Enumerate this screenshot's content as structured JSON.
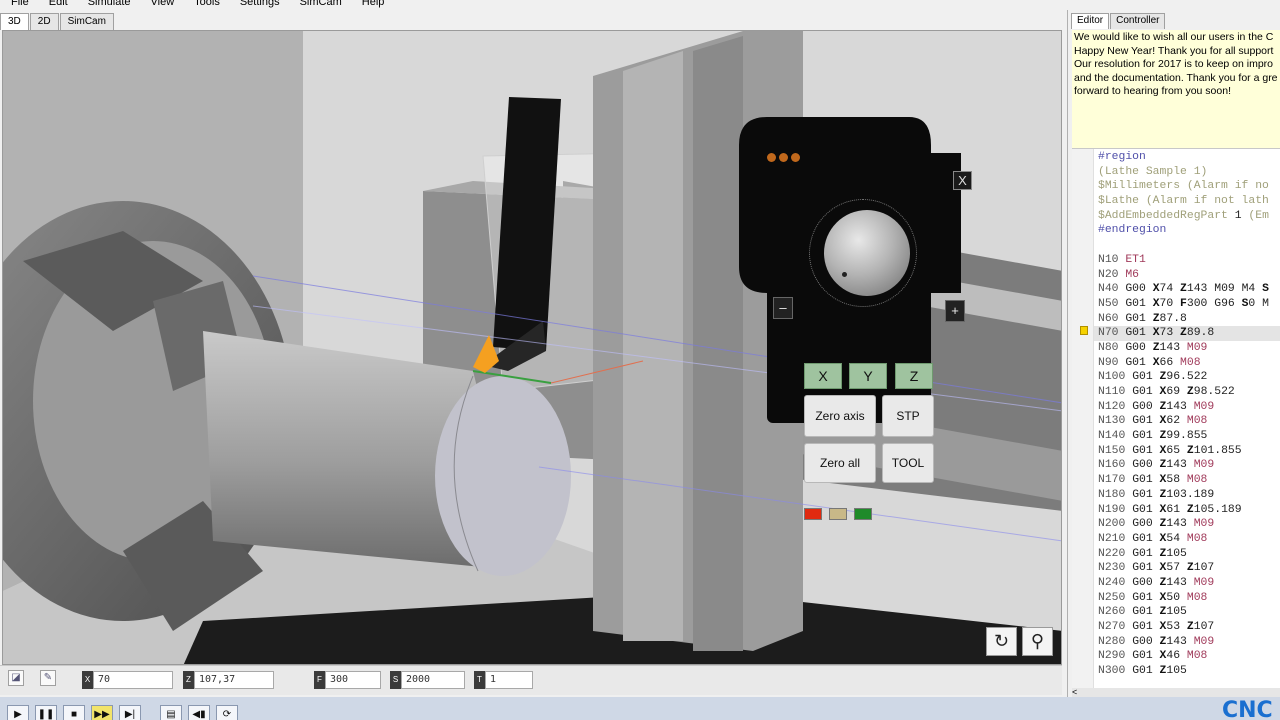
{
  "menu": [
    "File",
    "Edit",
    "Simulate",
    "View",
    "Tools",
    "Settings",
    "SimCam",
    "Help"
  ],
  "view_tabs": [
    "3D",
    "2D",
    "SimCam"
  ],
  "right_tabs": [
    "Editor",
    "Controller"
  ],
  "message": [
    "We would like to wish all our users in the C",
    "Happy New Year! Thank you for all support",
    "Our resolution for 2017 is to keep on impro",
    "and the documentation. Thank you for a gre",
    "forward to hearing from you soon!"
  ],
  "pendant": {
    "close": "X",
    "minus": "–",
    "plus": "+",
    "axes": [
      "X",
      "Y",
      "Z"
    ],
    "zero_axis": "Zero axis",
    "stp": "STP",
    "zero_all": "Zero all",
    "tool": "TOOL"
  },
  "statusbar": {
    "x": {
      "label": "X",
      "value": "70"
    },
    "z": {
      "label": "Z",
      "value": "107,37"
    },
    "f": {
      "label": "F",
      "value": "300"
    },
    "s": {
      "label": "S",
      "value": "2000"
    },
    "t": {
      "label": "T",
      "value": "1"
    }
  },
  "brand": "CNC",
  "colors": {
    "led_red": "#e02a10",
    "led_tan": "#c8b888",
    "led_green": "#1f8a2a",
    "tool_orange": "#f5a020",
    "axis_green": "#9fc39f"
  },
  "code_lines": [
    [
      [
        "#region",
        "kw"
      ]
    ],
    [
      [
        "(Lathe Sample 1)",
        "cm"
      ]
    ],
    [
      [
        "$Millimeters (Alarm if no",
        "cm"
      ]
    ],
    [
      [
        "$Lathe (Alarm if not lath",
        "cm"
      ]
    ],
    [
      [
        "$AddEmbeddedRegPart ",
        "cm"
      ],
      [
        "1",
        "n"
      ],
      [
        " (Em",
        "cm"
      ]
    ],
    [
      [
        "#endregion",
        "kw"
      ]
    ],
    [
      [
        "",
        ""
      ]
    ],
    [
      [
        "N10 ",
        "g"
      ],
      [
        "ET1",
        "m"
      ]
    ],
    [
      [
        "N20 ",
        "g"
      ],
      [
        "M6",
        "m"
      ]
    ],
    [
      [
        "N40 ",
        "g"
      ],
      [
        "G00 ",
        "n"
      ],
      [
        "X",
        "x"
      ],
      [
        "74 ",
        "n"
      ],
      [
        "Z",
        "x"
      ],
      [
        "143 ",
        "n"
      ],
      [
        "M09 M4 ",
        "n"
      ],
      [
        "S",
        "x"
      ]
    ],
    [
      [
        "N50 ",
        "g"
      ],
      [
        "G01 ",
        "n"
      ],
      [
        "X",
        "x"
      ],
      [
        "70 ",
        "n"
      ],
      [
        "F",
        "x"
      ],
      [
        "300 ",
        "n"
      ],
      [
        "G96 ",
        "n"
      ],
      [
        "S",
        "x"
      ],
      [
        "0 M",
        "n"
      ]
    ],
    [
      [
        "N60 ",
        "g"
      ],
      [
        "G01 ",
        "n"
      ],
      [
        "Z",
        "x"
      ],
      [
        "87.8",
        "n"
      ]
    ],
    [
      [
        "N70 ",
        "g"
      ],
      [
        "G01 ",
        "n"
      ],
      [
        "X",
        "x"
      ],
      [
        "73 ",
        "n"
      ],
      [
        "Z",
        "x"
      ],
      [
        "89.8",
        "n"
      ]
    ],
    [
      [
        "N80 ",
        "g"
      ],
      [
        "G00 ",
        "n"
      ],
      [
        "Z",
        "x"
      ],
      [
        "143 ",
        "n"
      ],
      [
        "M09",
        "m"
      ]
    ],
    [
      [
        "N90 ",
        "g"
      ],
      [
        "G01 ",
        "n"
      ],
      [
        "X",
        "x"
      ],
      [
        "66 ",
        "n"
      ],
      [
        "M08",
        "m"
      ]
    ],
    [
      [
        "N100 ",
        "g"
      ],
      [
        "G01 ",
        "n"
      ],
      [
        "Z",
        "x"
      ],
      [
        "96.522",
        "n"
      ]
    ],
    [
      [
        "N110 ",
        "g"
      ],
      [
        "G01 ",
        "n"
      ],
      [
        "X",
        "x"
      ],
      [
        "69 ",
        "n"
      ],
      [
        "Z",
        "x"
      ],
      [
        "98.522",
        "n"
      ]
    ],
    [
      [
        "N120 ",
        "g"
      ],
      [
        "G00 ",
        "n"
      ],
      [
        "Z",
        "x"
      ],
      [
        "143 ",
        "n"
      ],
      [
        "M09",
        "m"
      ]
    ],
    [
      [
        "N130 ",
        "g"
      ],
      [
        "G01 ",
        "n"
      ],
      [
        "X",
        "x"
      ],
      [
        "62 ",
        "n"
      ],
      [
        "M08",
        "m"
      ]
    ],
    [
      [
        "N140 ",
        "g"
      ],
      [
        "G01 ",
        "n"
      ],
      [
        "Z",
        "x"
      ],
      [
        "99.855",
        "n"
      ]
    ],
    [
      [
        "N150 ",
        "g"
      ],
      [
        "G01 ",
        "n"
      ],
      [
        "X",
        "x"
      ],
      [
        "65 ",
        "n"
      ],
      [
        "Z",
        "x"
      ],
      [
        "101.855",
        "n"
      ]
    ],
    [
      [
        "N160 ",
        "g"
      ],
      [
        "G00 ",
        "n"
      ],
      [
        "Z",
        "x"
      ],
      [
        "143 ",
        "n"
      ],
      [
        "M09",
        "m"
      ]
    ],
    [
      [
        "N170 ",
        "g"
      ],
      [
        "G01 ",
        "n"
      ],
      [
        "X",
        "x"
      ],
      [
        "58 ",
        "n"
      ],
      [
        "M08",
        "m"
      ]
    ],
    [
      [
        "N180 ",
        "g"
      ],
      [
        "G01 ",
        "n"
      ],
      [
        "Z",
        "x"
      ],
      [
        "103.189",
        "n"
      ]
    ],
    [
      [
        "N190 ",
        "g"
      ],
      [
        "G01 ",
        "n"
      ],
      [
        "X",
        "x"
      ],
      [
        "61 ",
        "n"
      ],
      [
        "Z",
        "x"
      ],
      [
        "105.189",
        "n"
      ]
    ],
    [
      [
        "N200 ",
        "g"
      ],
      [
        "G00 ",
        "n"
      ],
      [
        "Z",
        "x"
      ],
      [
        "143 ",
        "n"
      ],
      [
        "M09",
        "m"
      ]
    ],
    [
      [
        "N210 ",
        "g"
      ],
      [
        "G01 ",
        "n"
      ],
      [
        "X",
        "x"
      ],
      [
        "54 ",
        "n"
      ],
      [
        "M08",
        "m"
      ]
    ],
    [
      [
        "N220 ",
        "g"
      ],
      [
        "G01 ",
        "n"
      ],
      [
        "Z",
        "x"
      ],
      [
        "105",
        "n"
      ]
    ],
    [
      [
        "N230 ",
        "g"
      ],
      [
        "G01 ",
        "n"
      ],
      [
        "X",
        "x"
      ],
      [
        "57 ",
        "n"
      ],
      [
        "Z",
        "x"
      ],
      [
        "107",
        "n"
      ]
    ],
    [
      [
        "N240 ",
        "g"
      ],
      [
        "G00 ",
        "n"
      ],
      [
        "Z",
        "x"
      ],
      [
        "143 ",
        "n"
      ],
      [
        "M09",
        "m"
      ]
    ],
    [
      [
        "N250 ",
        "g"
      ],
      [
        "G01 ",
        "n"
      ],
      [
        "X",
        "x"
      ],
      [
        "50 ",
        "n"
      ],
      [
        "M08",
        "m"
      ]
    ],
    [
      [
        "N260 ",
        "g"
      ],
      [
        "G01 ",
        "n"
      ],
      [
        "Z",
        "x"
      ],
      [
        "105",
        "n"
      ]
    ],
    [
      [
        "N270 ",
        "g"
      ],
      [
        "G01 ",
        "n"
      ],
      [
        "X",
        "x"
      ],
      [
        "53 ",
        "n"
      ],
      [
        "Z",
        "x"
      ],
      [
        "107",
        "n"
      ]
    ],
    [
      [
        "N280 ",
        "g"
      ],
      [
        "G00 ",
        "n"
      ],
      [
        "Z",
        "x"
      ],
      [
        "143 ",
        "n"
      ],
      [
        "M09",
        "m"
      ]
    ],
    [
      [
        "N290 ",
        "g"
      ],
      [
        "G01 ",
        "n"
      ],
      [
        "X",
        "x"
      ],
      [
        "46 ",
        "n"
      ],
      [
        "M08",
        "m"
      ]
    ],
    [
      [
        "N300 ",
        "g"
      ],
      [
        "G01 ",
        "n"
      ],
      [
        "Z",
        "x"
      ],
      [
        "105",
        "n"
      ]
    ]
  ],
  "highlighted_line": 12,
  "hscroll_arrow": "<"
}
